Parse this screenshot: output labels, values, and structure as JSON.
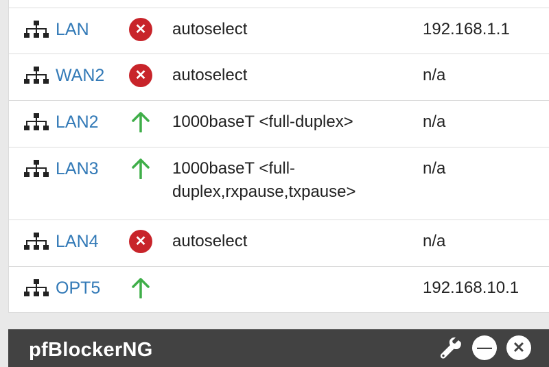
{
  "interfaces": [
    {
      "name": "LAN",
      "status": "down",
      "media": "autoselect",
      "ip": "192.168.1.1"
    },
    {
      "name": "WAN2",
      "status": "down",
      "media": "autoselect",
      "ip": "n/a"
    },
    {
      "name": "LAN2",
      "status": "up",
      "media": "1000baseT <full-duplex>",
      "ip": "n/a"
    },
    {
      "name": "LAN3",
      "status": "up",
      "media": "1000baseT <full-duplex,rxpause,txpause>",
      "ip": "n/a"
    },
    {
      "name": "LAN4",
      "status": "down",
      "media": "autoselect",
      "ip": "n/a"
    },
    {
      "name": "OPT5",
      "status": "up",
      "media": "",
      "ip": "192.168.10.1"
    }
  ],
  "widget": {
    "title": "pfBlockerNG"
  },
  "icons": {
    "interface": "network-icon",
    "status_up": "arrow-up-icon",
    "status_down": "x-circle-icon",
    "wrench": "wrench-icon",
    "minimize": "minus-circle-icon",
    "close": "close-circle-icon"
  },
  "colors": {
    "link": "#337ab7",
    "status_down": "#c8242a",
    "status_up": "#3fae49",
    "header": "#424242"
  }
}
